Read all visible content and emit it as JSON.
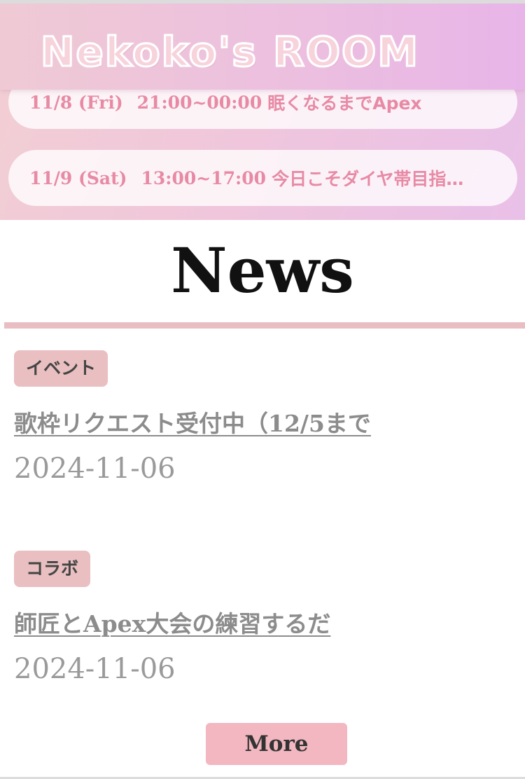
{
  "header": {
    "logo_text": "Nekoko's ROOM"
  },
  "schedule": [
    {
      "date": "11/8 (Fri)",
      "time": "21:00~00:00",
      "title": "眠くなるまでApex"
    },
    {
      "date": "11/9 (Sat)",
      "time": "13:00~17:00",
      "title": "今日こそダイヤ帯目指…"
    }
  ],
  "news": {
    "heading": "News",
    "items": [
      {
        "category": "イベント",
        "title": "歌枠リクエスト受付中（12/5まで",
        "date": "2024-11-06"
      },
      {
        "category": "コラボ",
        "title": "師匠とApex大会の練習するだ",
        "date": "2024-11-06"
      }
    ],
    "more_label": "More"
  },
  "colors": {
    "accent_pink": "#f2b7c0",
    "badge_pink": "#e9bfc1",
    "schedule_text": "#e88aa5",
    "header_gradient_start": "#efcad4",
    "header_gradient_end": "#e8b5e8"
  }
}
